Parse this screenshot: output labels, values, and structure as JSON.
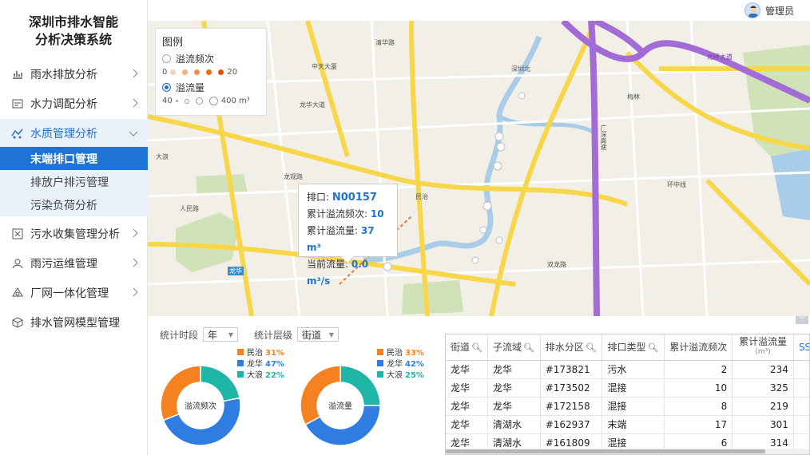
{
  "app": {
    "title_line1": "深圳市排水智能",
    "title_line2": "分析决策系统"
  },
  "sidebar": {
    "items": [
      {
        "label": "雨水排放分析",
        "icon": "rain-chart-icon"
      },
      {
        "label": "水力调配分析",
        "icon": "hydraulic-icon"
      },
      {
        "label": "水质管理分析",
        "icon": "water-quality-icon"
      },
      {
        "label": "污水收集管理分析",
        "icon": "sewage-icon"
      },
      {
        "label": "雨污运维管理",
        "icon": "maintenance-icon"
      },
      {
        "label": "厂网一体化管理",
        "icon": "network-icon"
      },
      {
        "label": "排水管网模型管理",
        "icon": "cube-icon"
      }
    ],
    "sub_items": [
      {
        "label": "末端排口管理"
      },
      {
        "label": "排放户排污管理"
      },
      {
        "label": "污染负荷分析"
      }
    ]
  },
  "user": {
    "name": "管理员"
  },
  "legend": {
    "title": "图例",
    "overflow_count_label": "溢流频次",
    "count_min": "0",
    "count_max": "20",
    "overflow_volume_label": "溢流量",
    "volume_min": "40",
    "volume_max": "400 m³",
    "count_colors": [
      "#f9d4b8",
      "#f6b07f",
      "#f28d4a",
      "#ef6a1a",
      "#e04e0b"
    ]
  },
  "popup": {
    "outlet_label": "排口:",
    "outlet_value": "N00157",
    "count_label": "累计溢流频次:",
    "count_value": "10",
    "volume_label": "累计溢流量:",
    "volume_value": "37 m³",
    "flow_label": "当前流量:",
    "flow_value": "0.0 m³/s"
  },
  "map_labels": {
    "qingshui": "清华路",
    "zhongtian": "中天大厦",
    "shenzhen_north": "深圳北",
    "longhua": "龙华",
    "minzhi": "民治",
    "dalang": "大浪",
    "meilin": "梅林",
    "beihuan": "北环大道",
    "guangshen": "广深高速",
    "huanzhong": "环中线",
    "renmin": "人民路",
    "longguan": "龙观路",
    "longhua_road": "龙华大道",
    "shuanglong": "双龙路"
  },
  "filters": {
    "period_label": "统计时段",
    "period_value": "年",
    "level_label": "统计层级",
    "level_value": "街道"
  },
  "chart_data": [
    {
      "type": "pie",
      "title": "溢流频次",
      "categories": [
        "民治",
        "龙华",
        "大浪"
      ],
      "values": [
        31,
        47,
        22
      ],
      "colors": [
        "#f58220",
        "#2f7de1",
        "#1fb5a7"
      ]
    },
    {
      "type": "pie",
      "title": "溢流量",
      "categories": [
        "民治",
        "龙华",
        "大浪"
      ],
      "values": [
        33,
        42,
        25
      ],
      "colors": [
        "#f58220",
        "#2f7de1",
        "#1fb5a7"
      ]
    }
  ],
  "table": {
    "headers": [
      "街道",
      "子流域",
      "排水分区",
      "排口类型",
      "累计溢流频次",
      "累计溢流量",
      "SS"
    ],
    "volume_unit": "(m³)",
    "rows": [
      [
        "龙华",
        "龙华",
        "#173821",
        "污水",
        "2",
        "234"
      ],
      [
        "龙华",
        "龙华",
        "#173502",
        "混接",
        "10",
        "325"
      ],
      [
        "龙华",
        "龙华",
        "#172158",
        "混接",
        "8",
        "219"
      ],
      [
        "龙华",
        "清湖水",
        "#162937",
        "末端",
        "17",
        "301"
      ],
      [
        "龙华",
        "清湖水",
        "#161809",
        "混接",
        "6",
        "314"
      ]
    ]
  }
}
